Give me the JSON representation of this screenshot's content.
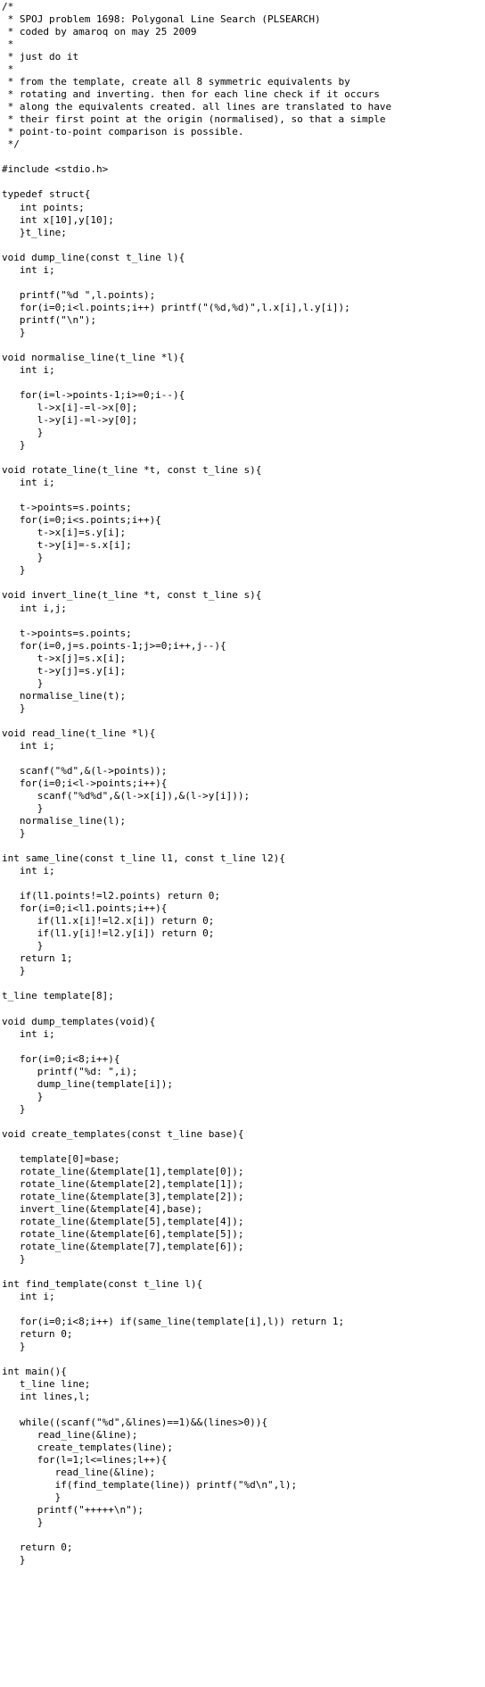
{
  "document": {
    "lines": [
      "/*",
      " * SPOJ problem 1698: Polygonal Line Search (PLSEARCH)",
      " * coded by amaroq on may 25 2009",
      " *",
      " * just do it",
      " *",
      " * from the template, create all 8 symmetric equivalents by",
      " * rotating and inverting. then for each line check if it occurs",
      " * along the equivalents created. all lines are translated to have",
      " * their first point at the origin (normalised), so that a simple",
      " * point-to-point comparison is possible.",
      " */",
      "",
      "#include <stdio.h>",
      "",
      "typedef struct{",
      "   int points;",
      "   int x[10],y[10];",
      "   }t_line;",
      "",
      "void dump_line(const t_line l){",
      "   int i;",
      "",
      "   printf(\"%d \",l.points);",
      "   for(i=0;i<l.points;i++) printf(\"(%d,%d)\",l.x[i],l.y[i]);",
      "   printf(\"\\n\");",
      "   }",
      "",
      "void normalise_line(t_line *l){",
      "   int i;",
      "",
      "   for(i=l->points-1;i>=0;i--){",
      "      l->x[i]-=l->x[0];",
      "      l->y[i]-=l->y[0];",
      "      }",
      "   }",
      "",
      "void rotate_line(t_line *t, const t_line s){",
      "   int i;",
      "",
      "   t->points=s.points;",
      "   for(i=0;i<s.points;i++){",
      "      t->x[i]=s.y[i];",
      "      t->y[i]=-s.x[i];",
      "      }",
      "   }",
      "",
      "void invert_line(t_line *t, const t_line s){",
      "   int i,j;",
      "",
      "   t->points=s.points;",
      "   for(i=0,j=s.points-1;j>=0;i++,j--){",
      "      t->x[j]=s.x[i];",
      "      t->y[j]=s.y[i];",
      "      }",
      "   normalise_line(t);",
      "   }",
      "",
      "void read_line(t_line *l){",
      "   int i;",
      "",
      "   scanf(\"%d\",&(l->points));",
      "   for(i=0;i<l->points;i++){",
      "      scanf(\"%d%d\",&(l->x[i]),&(l->y[i]));",
      "      }",
      "   normalise_line(l);",
      "   }",
      "",
      "int same_line(const t_line l1, const t_line l2){",
      "   int i;",
      "",
      "   if(l1.points!=l2.points) return 0;",
      "   for(i=0;i<l1.points;i++){",
      "      if(l1.x[i]!=l2.x[i]) return 0;",
      "      if(l1.y[i]!=l2.y[i]) return 0;",
      "      }",
      "   return 1;",
      "   }",
      "",
      "t_line template[8];",
      "",
      "void dump_templates(void){",
      "   int i;",
      "",
      "   for(i=0;i<8;i++){",
      "      printf(\"%d: \",i);",
      "      dump_line(template[i]);",
      "      }",
      "   }",
      "",
      "void create_templates(const t_line base){",
      "",
      "   template[0]=base;",
      "   rotate_line(&template[1],template[0]);",
      "   rotate_line(&template[2],template[1]);",
      "   rotate_line(&template[3],template[2]);",
      "   invert_line(&template[4],base);",
      "   rotate_line(&template[5],template[4]);",
      "   rotate_line(&template[6],template[5]);",
      "   rotate_line(&template[7],template[6]);",
      "   }",
      "",
      "int find_template(const t_line l){",
      "   int i;",
      "",
      "   for(i=0;i<8;i++) if(same_line(template[i],l)) return 1;",
      "   return 0;",
      "   }",
      "",
      "int main(){",
      "   t_line line;",
      "   int lines,l;",
      "",
      "   while((scanf(\"%d\",&lines)==1)&&(lines>0)){",
      "      read_line(&line);",
      "      create_templates(line);",
      "      for(l=1;l<=lines;l++){",
      "         read_line(&line);",
      "         if(find_template(line)) printf(\"%d\\n\",l);",
      "         }",
      "      printf(\"+++++\\n\");",
      "      }",
      "",
      "   return 0;",
      "   }"
    ]
  }
}
